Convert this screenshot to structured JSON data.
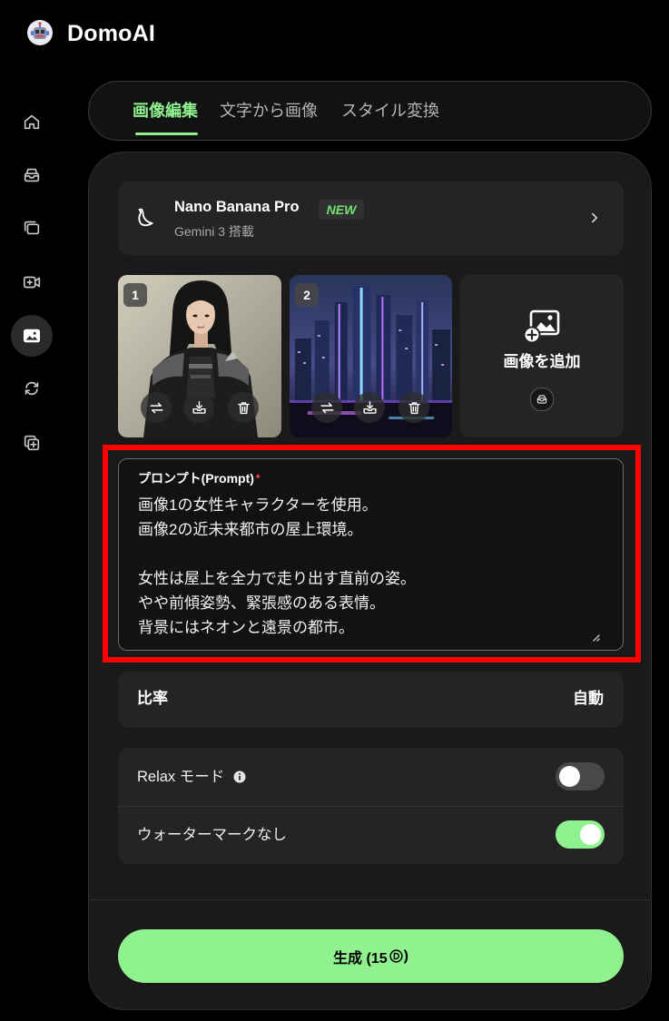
{
  "app": {
    "name": "DomoAI",
    "logo_icon": "robot-avatar-icon"
  },
  "colors": {
    "accent": "#8ff28f",
    "highlight_box": "#ff0000",
    "required_mark": "#ff4d4d"
  },
  "sidebar": {
    "items": [
      {
        "icon": "home-icon",
        "active": false
      },
      {
        "icon": "inbox-icon",
        "active": false
      },
      {
        "icon": "layers-icon",
        "active": false
      },
      {
        "icon": "video-plus-icon",
        "active": false
      },
      {
        "icon": "image-icon",
        "active": true
      },
      {
        "icon": "swap-refresh-icon",
        "active": false
      },
      {
        "icon": "copy-plus-icon",
        "active": false
      }
    ]
  },
  "tabs": [
    {
      "label": "画像編集",
      "active": true
    },
    {
      "label": "文字から画像",
      "active": false
    },
    {
      "label": "スタイル変換",
      "active": false
    }
  ],
  "model": {
    "icon": "banana-icon",
    "name": "Nano Banana Pro",
    "badge": "NEW",
    "subtitle": "Gemini 3 搭載"
  },
  "reference_images": [
    {
      "index": "1",
      "actions": [
        "swap-icon",
        "save-to-library-icon",
        "trash-icon"
      ]
    },
    {
      "index": "2",
      "actions": [
        "swap-icon",
        "save-to-library-icon",
        "trash-icon"
      ]
    }
  ],
  "add_image": {
    "label": "画像を追加",
    "icon": "image-plus-icon",
    "library_icon": "library-tray-icon"
  },
  "prompt": {
    "label": "プロンプト(Prompt)",
    "required_mark": "*",
    "value": "画像1の女性キャラクターを使用。\n画像2の近未来都市の屋上環境。\n\n女性は屋上を全力で走り出す直前の姿。\nやや前傾姿勢、緊張感のある表情。\n背景にはネオンと遠景の都市。"
  },
  "aspect_ratio": {
    "label": "比率",
    "value": "自動"
  },
  "settings": {
    "relax_mode": {
      "label": "Relax モード",
      "enabled": false
    },
    "no_watermark": {
      "label": "ウォーターマークなし",
      "enabled": true
    }
  },
  "generate": {
    "text_before_icon": "生成 (15",
    "text_after_icon": ")",
    "icon": "credit-coin-icon"
  }
}
